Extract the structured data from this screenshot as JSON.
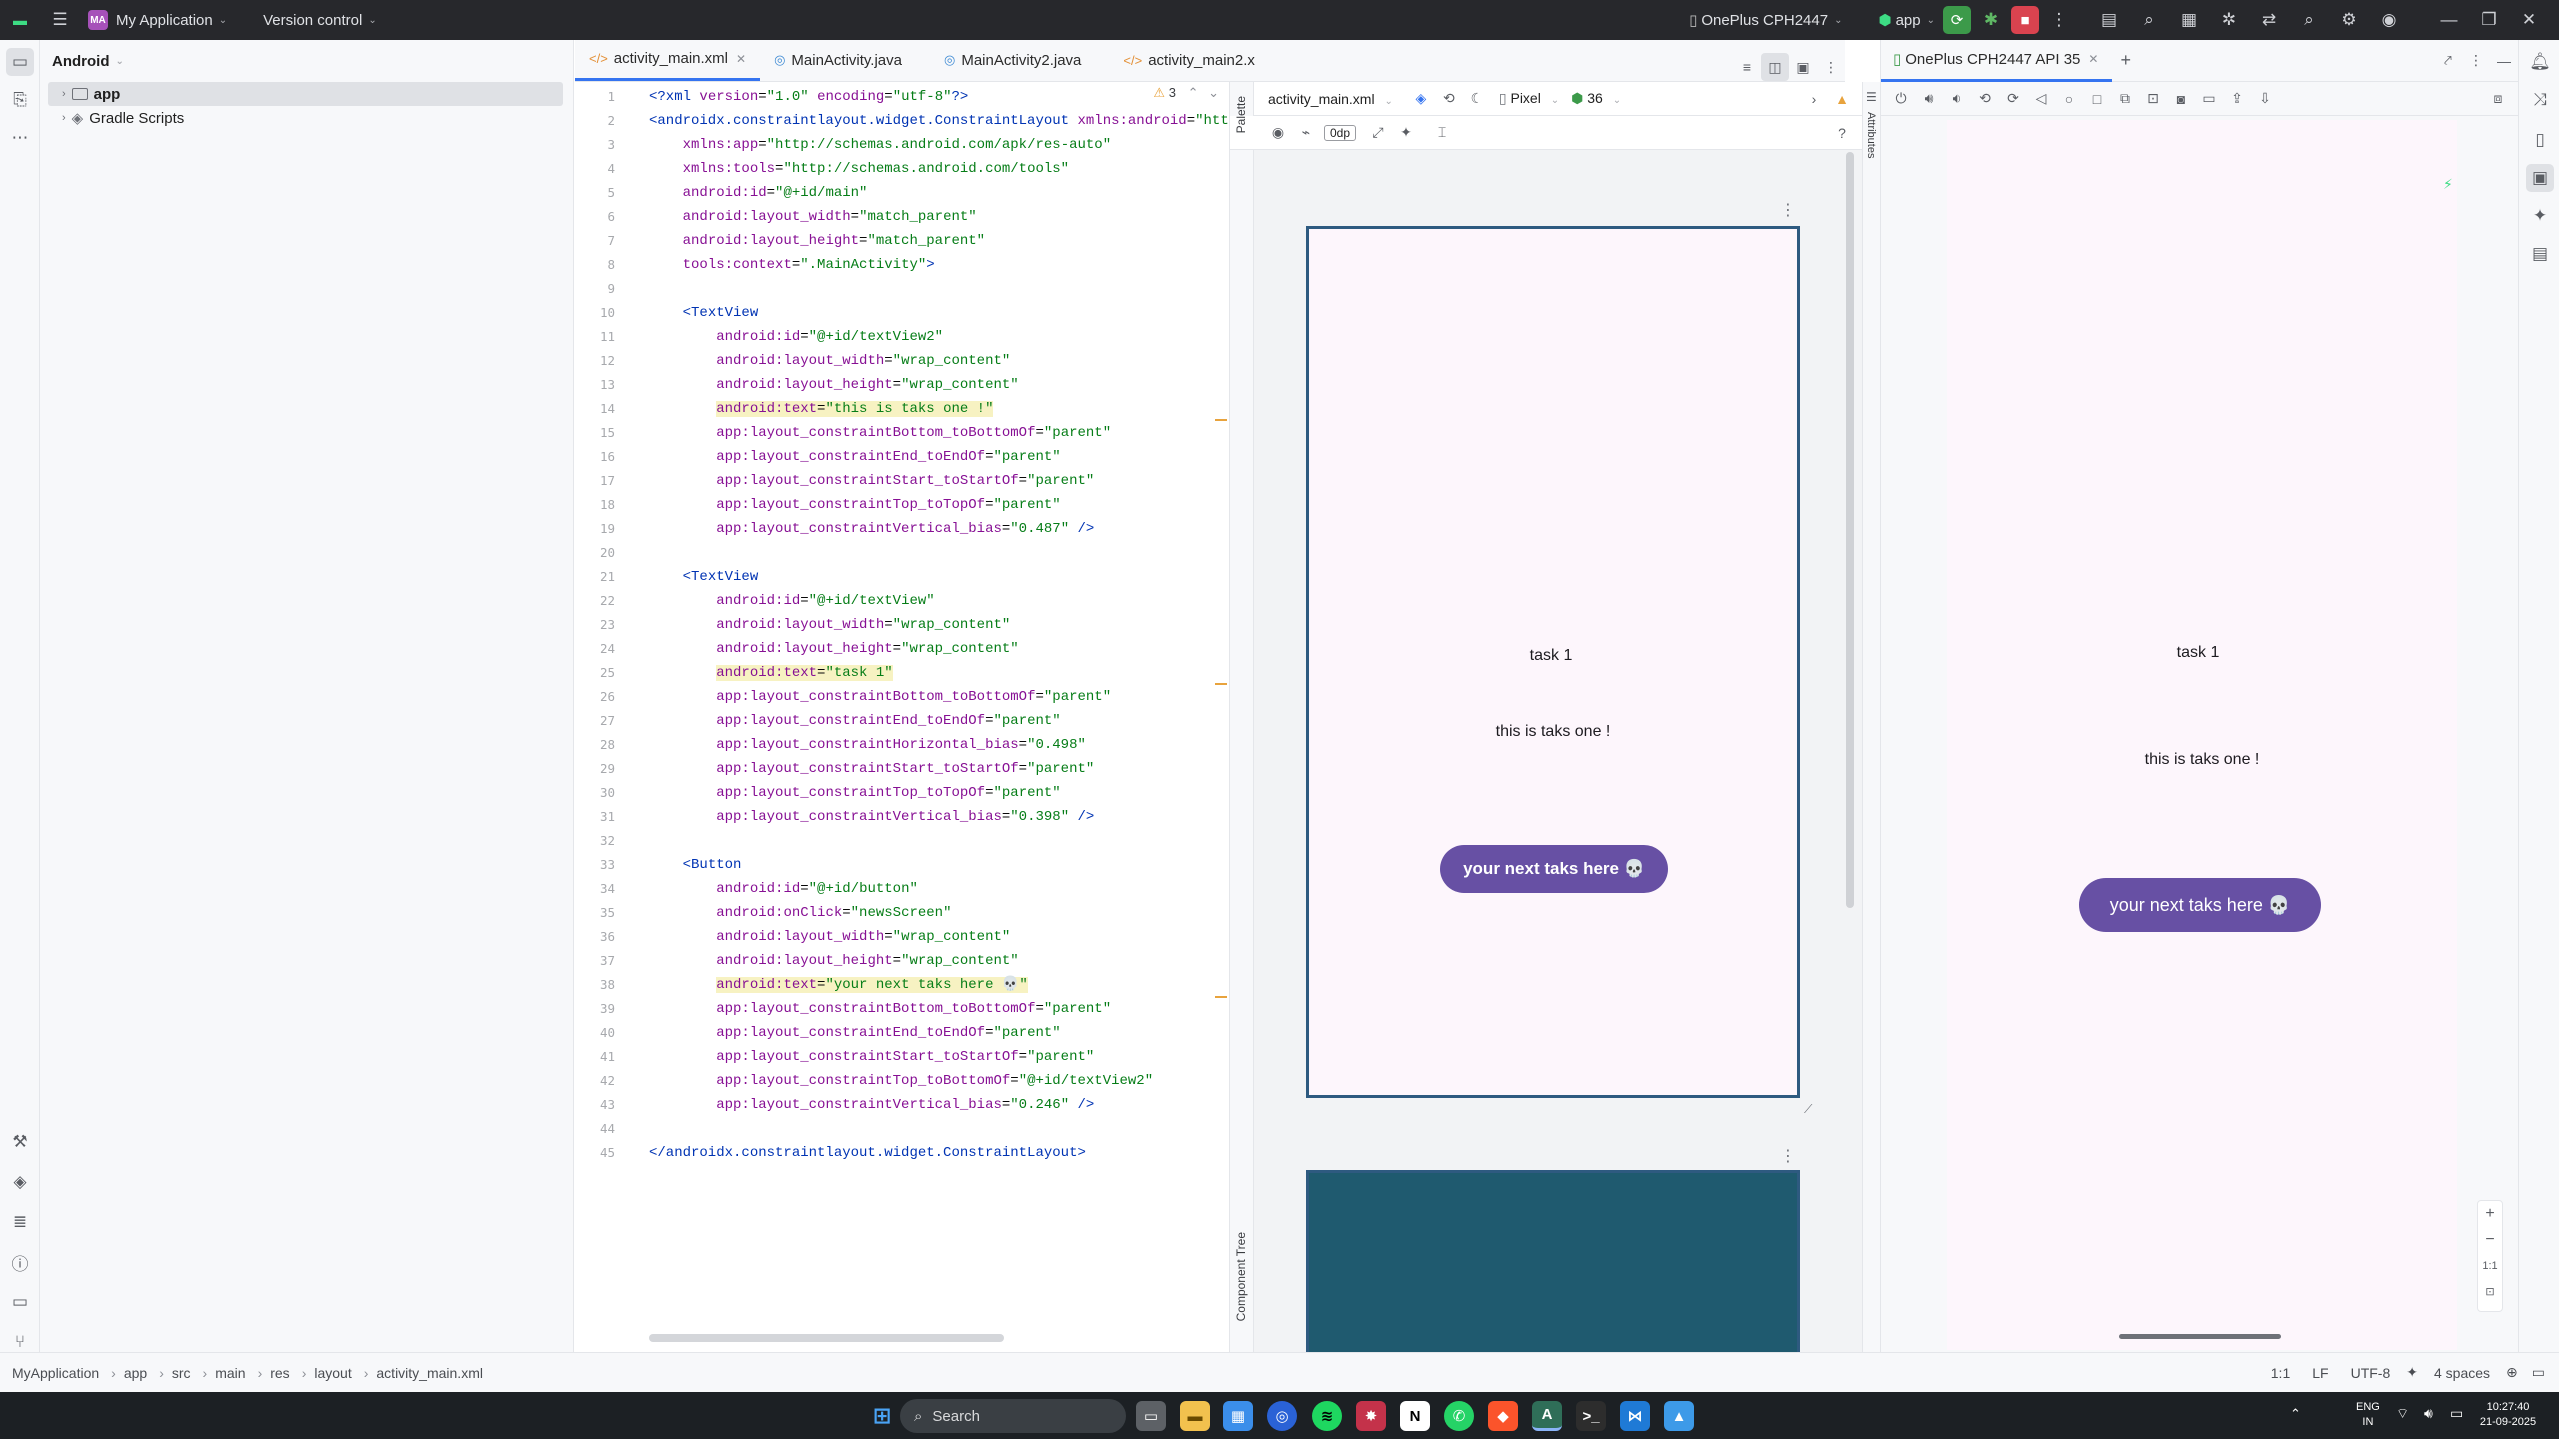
{
  "titlebar": {
    "project_badge": "MA",
    "project_name": "My Application",
    "vcs": "Version control",
    "device": "OnePlus CPH2447",
    "run_config": "app"
  },
  "project_panel": {
    "view": "Android",
    "items": [
      {
        "label": "app"
      },
      {
        "label": "Gradle Scripts"
      }
    ]
  },
  "tabs": [
    {
      "label": "activity_main.xml"
    },
    {
      "label": "MainActivity.java"
    },
    {
      "label": "MainActivity2.java"
    },
    {
      "label": "activity_main2.x"
    }
  ],
  "editor": {
    "warning_count": "3",
    "lines": [
      {
        "n": "1",
        "html": "<span class='tag'>&lt;?xml</span> <span class='attr'>version</span>=<span class='val'>\"1.0\"</span> <span class='attr'>encoding</span>=<span class='val'>\"utf-8\"</span><span class='tag'>?&gt;</span>"
      },
      {
        "n": "2",
        "html": "<span class='tag'>&lt;androidx.constraintlayout.widget.ConstraintLayout</span> <span class='ns'>xmlns:android</span>=<span class='val'>\"http:/</span>"
      },
      {
        "n": "3",
        "html": "    <span class='ns'>xmlns:app</span>=<span class='val'>\"http://schemas.android.com/apk/res-auto\"</span>"
      },
      {
        "n": "4",
        "html": "    <span class='ns'>xmlns:tools</span>=<span class='val'>\"http://schemas.android.com/tools\"</span>"
      },
      {
        "n": "5",
        "html": "    <span class='ns'>android:</span><span class='attr'>id</span>=<span class='val'>\"@+id/main\"</span>"
      },
      {
        "n": "6",
        "html": "    <span class='ns'>android:</span><span class='attr'>layout_width</span>=<span class='val'>\"match_parent\"</span>"
      },
      {
        "n": "7",
        "html": "    <span class='ns'>android:</span><span class='attr'>layout_height</span>=<span class='val'>\"match_parent\"</span>"
      },
      {
        "n": "8",
        "html": "    <span class='ns'>tools:</span><span class='attr'>context</span>=<span class='val'>\".MainActivity\"</span><span class='tag'>&gt;</span>"
      },
      {
        "n": "9",
        "html": ""
      },
      {
        "n": "10",
        "html": "    <span class='tag'>&lt;TextView</span>"
      },
      {
        "n": "11",
        "html": "        <span class='ns'>android:</span><span class='attr'>id</span>=<span class='val'>\"@+id/textView2\"</span>"
      },
      {
        "n": "12",
        "html": "        <span class='ns'>android:</span><span class='attr'>layout_width</span>=<span class='val'>\"wrap_content\"</span>"
      },
      {
        "n": "13",
        "html": "        <span class='ns'>android:</span><span class='attr'>layout_height</span>=<span class='val'>\"wrap_content\"</span>"
      },
      {
        "n": "14",
        "html": "        <span class='hl'><span class='ns'>android:</span><span class='attr'>text</span>=<span class='val'>\"this is taks one !\"</span></span>"
      },
      {
        "n": "15",
        "html": "        <span class='ns'>app:</span><span class='attr'>layout_constraintBottom_toBottomOf</span>=<span class='val'>\"parent\"</span>"
      },
      {
        "n": "16",
        "html": "        <span class='ns'>app:</span><span class='attr'>layout_constraintEnd_toEndOf</span>=<span class='val'>\"parent\"</span>"
      },
      {
        "n": "17",
        "html": "        <span class='ns'>app:</span><span class='attr'>layout_constraintStart_toStartOf</span>=<span class='val'>\"parent\"</span>"
      },
      {
        "n": "18",
        "html": "        <span class='ns'>app:</span><span class='attr'>layout_constraintTop_toTopOf</span>=<span class='val'>\"parent\"</span>"
      },
      {
        "n": "19",
        "html": "        <span class='ns'>app:</span><span class='attr'>layout_constraintVertical_bias</span>=<span class='val'>\"0.487\"</span> <span class='tag'>/&gt;</span>"
      },
      {
        "n": "20",
        "html": ""
      },
      {
        "n": "21",
        "html": "    <span class='tag'>&lt;TextView</span>"
      },
      {
        "n": "22",
        "html": "        <span class='ns'>android:</span><span class='attr'>id</span>=<span class='val'>\"@+id/textView\"</span>"
      },
      {
        "n": "23",
        "html": "        <span class='ns'>android:</span><span class='attr'>layout_width</span>=<span class='val'>\"wrap_content\"</span>"
      },
      {
        "n": "24",
        "html": "        <span class='ns'>android:</span><span class='attr'>layout_height</span>=<span class='val'>\"wrap_content\"</span>"
      },
      {
        "n": "25",
        "html": "        <span class='hl'><span class='ns'>android:</span><span class='attr'>text</span>=<span class='val'>\"task 1\"</span></span>"
      },
      {
        "n": "26",
        "html": "        <span class='ns'>app:</span><span class='attr'>layout_constraintBottom_toBottomOf</span>=<span class='val'>\"parent\"</span>"
      },
      {
        "n": "27",
        "html": "        <span class='ns'>app:</span><span class='attr'>layout_constraintEnd_toEndOf</span>=<span class='val'>\"parent\"</span>"
      },
      {
        "n": "28",
        "html": "        <span class='ns'>app:</span><span class='attr'>layout_constraintHorizontal_bias</span>=<span class='val'>\"0.498\"</span>"
      },
      {
        "n": "29",
        "html": "        <span class='ns'>app:</span><span class='attr'>layout_constraintStart_toStartOf</span>=<span class='val'>\"parent\"</span>"
      },
      {
        "n": "30",
        "html": "        <span class='ns'>app:</span><span class='attr'>layout_constraintTop_toTopOf</span>=<span class='val'>\"parent\"</span>"
      },
      {
        "n": "31",
        "html": "        <span class='ns'>app:</span><span class='attr'>layout_constraintVertical_bias</span>=<span class='val'>\"0.398\"</span> <span class='tag'>/&gt;</span>"
      },
      {
        "n": "32",
        "html": ""
      },
      {
        "n": "33",
        "html": "    <span class='tag'>&lt;Button</span>"
      },
      {
        "n": "34",
        "html": "        <span class='ns'>android:</span><span class='attr'>id</span>=<span class='val'>\"@+id/button\"</span>"
      },
      {
        "n": "35",
        "html": "        <span class='ns'>android:</span><span class='attr'>onClick</span>=<span class='val'>\"newsScreen\"</span>"
      },
      {
        "n": "36",
        "html": "        <span class='ns'>android:</span><span class='attr'>layout_width</span>=<span class='val'>\"wrap_content\"</span>"
      },
      {
        "n": "37",
        "html": "        <span class='ns'>android:</span><span class='attr'>layout_height</span>=<span class='val'>\"wrap_content\"</span>"
      },
      {
        "n": "38",
        "html": "        <span class='hl'><span class='ns'>android:</span><span class='attr'>text</span>=<span class='val'>\"your next taks here 💀\"</span></span>"
      },
      {
        "n": "39",
        "html": "        <span class='ns'>app:</span><span class='attr'>layout_constraintBottom_toBottomOf</span>=<span class='val'>\"parent\"</span>"
      },
      {
        "n": "40",
        "html": "        <span class='ns'>app:</span><span class='attr'>layout_constraintEnd_toEndOf</span>=<span class='val'>\"parent\"</span>"
      },
      {
        "n": "41",
        "html": "        <span class='ns'>app:</span><span class='attr'>layout_constraintStart_toStartOf</span>=<span class='val'>\"parent\"</span>"
      },
      {
        "n": "42",
        "html": "        <span class='ns'>app:</span><span class='attr'>layout_constraintTop_toBottomOf</span>=<span class='val'>\"@+id/textView2\"</span>"
      },
      {
        "n": "43",
        "html": "        <span class='ns'>app:</span><span class='attr'>layout_constraintVertical_bias</span>=<span class='val'>\"0.246\"</span> <span class='tag'>/&gt;</span>"
      },
      {
        "n": "44",
        "html": ""
      },
      {
        "n": "45",
        "html": "<span class='tag'>&lt;/androidx.constraintlayout.widget.ConstraintLayout&gt;</span>"
      }
    ]
  },
  "design": {
    "file": "activity_main.xml",
    "device": "Pixel",
    "api": "36",
    "margin": "0dp",
    "palette_label": "Palette",
    "component_tree_label": "Component Tree",
    "attributes_label": "Attributes",
    "preview": {
      "title_text": "task 1",
      "body_text": "this is taks one !",
      "button_text": "your next taks here 💀"
    }
  },
  "running": {
    "tab_label": "OnePlus CPH2447 API 35",
    "screen": {
      "title_text": "task 1",
      "body_text": "this is taks one !",
      "button_text": "your next taks here 💀"
    },
    "zoom_label": "1:1"
  },
  "statusbar": {
    "breadcrumbs": [
      "MyApplication",
      "app",
      "src",
      "main",
      "res",
      "layout",
      "activity_main.xml"
    ],
    "position": "1:1",
    "line_sep": "LF",
    "encoding": "UTF-8",
    "indent": "4 spaces"
  },
  "taskbar": {
    "search_label": "Search",
    "lang_line1": "ENG",
    "lang_line2": "IN",
    "time": "10:27:40",
    "date": "21-09-2025"
  },
  "colors": {
    "accent": "#3574f0",
    "button_purple": "#6750a4",
    "run_green": "#3c9a4a",
    "stop_red": "#d9434f"
  }
}
